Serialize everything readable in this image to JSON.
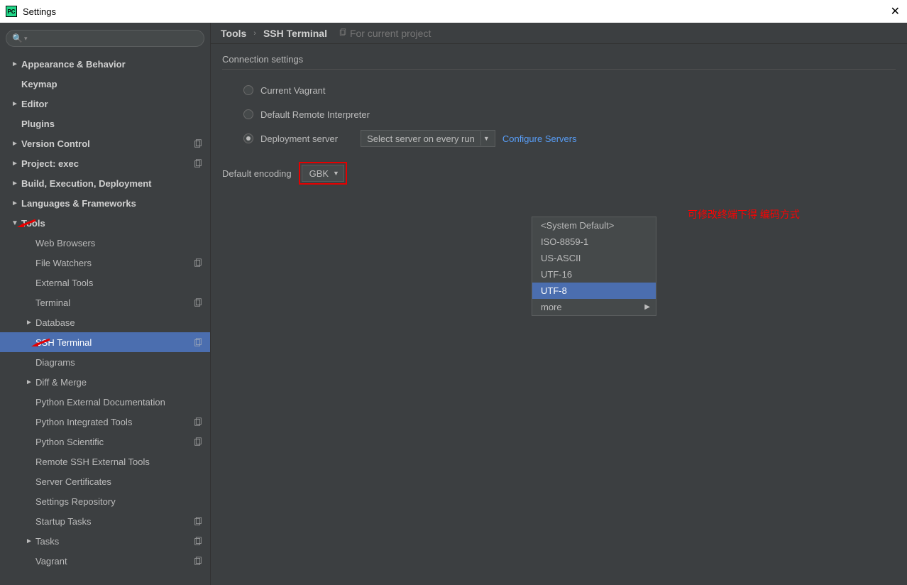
{
  "window": {
    "title": "Settings"
  },
  "breadcrumb": {
    "crumb1": "Tools",
    "crumb2": "SSH Terminal",
    "project_scope": "For current project"
  },
  "sidebar": {
    "items": [
      {
        "label": "Appearance & Behavior",
        "bold": true,
        "exp": "►",
        "copy": false,
        "lvl": 0
      },
      {
        "label": "Keymap",
        "bold": true,
        "exp": "",
        "copy": false,
        "lvl": 0
      },
      {
        "label": "Editor",
        "bold": true,
        "exp": "►",
        "copy": false,
        "lvl": 0
      },
      {
        "label": "Plugins",
        "bold": true,
        "exp": "",
        "copy": false,
        "lvl": 0
      },
      {
        "label": "Version Control",
        "bold": true,
        "exp": "►",
        "copy": true,
        "lvl": 0
      },
      {
        "label": "Project: exec",
        "bold": true,
        "exp": "►",
        "copy": true,
        "lvl": 0
      },
      {
        "label": "Build, Execution, Deployment",
        "bold": true,
        "exp": "►",
        "copy": false,
        "lvl": 0
      },
      {
        "label": "Languages & Frameworks",
        "bold": true,
        "exp": "►",
        "copy": false,
        "lvl": 0
      },
      {
        "label": "Tools",
        "bold": true,
        "exp": "▼",
        "copy": false,
        "lvl": 0,
        "arrow": true
      },
      {
        "label": "Web Browsers",
        "bold": false,
        "exp": "",
        "copy": false,
        "lvl": 1
      },
      {
        "label": "File Watchers",
        "bold": false,
        "exp": "",
        "copy": true,
        "lvl": 1
      },
      {
        "label": "External Tools",
        "bold": false,
        "exp": "",
        "copy": false,
        "lvl": 1
      },
      {
        "label": "Terminal",
        "bold": false,
        "exp": "",
        "copy": true,
        "lvl": 1
      },
      {
        "label": "Database",
        "bold": false,
        "exp": "►",
        "copy": false,
        "lvl": 1
      },
      {
        "label": "SSH Terminal",
        "bold": false,
        "exp": "",
        "copy": true,
        "lvl": 1,
        "selected": true,
        "arrow": true
      },
      {
        "label": "Diagrams",
        "bold": false,
        "exp": "",
        "copy": false,
        "lvl": 1
      },
      {
        "label": "Diff & Merge",
        "bold": false,
        "exp": "►",
        "copy": false,
        "lvl": 1
      },
      {
        "label": "Python External Documentation",
        "bold": false,
        "exp": "",
        "copy": false,
        "lvl": 1
      },
      {
        "label": "Python Integrated Tools",
        "bold": false,
        "exp": "",
        "copy": true,
        "lvl": 1
      },
      {
        "label": "Python Scientific",
        "bold": false,
        "exp": "",
        "copy": true,
        "lvl": 1
      },
      {
        "label": "Remote SSH External Tools",
        "bold": false,
        "exp": "",
        "copy": false,
        "lvl": 1
      },
      {
        "label": "Server Certificates",
        "bold": false,
        "exp": "",
        "copy": false,
        "lvl": 1
      },
      {
        "label": "Settings Repository",
        "bold": false,
        "exp": "",
        "copy": false,
        "lvl": 1
      },
      {
        "label": "Startup Tasks",
        "bold": false,
        "exp": "",
        "copy": true,
        "lvl": 1
      },
      {
        "label": "Tasks",
        "bold": false,
        "exp": "►",
        "copy": true,
        "lvl": 1
      },
      {
        "label": "Vagrant",
        "bold": false,
        "exp": "",
        "copy": true,
        "lvl": 1
      }
    ]
  },
  "content": {
    "section_title": "Connection settings",
    "radio1": "Current Vagrant",
    "radio2": "Default Remote Interpreter",
    "radio3": "Deployment server",
    "combo_server": "Select server on every run",
    "link_configure": "Configure Servers",
    "enc_label": "Default encoding",
    "enc_value": "GBK",
    "annotation": "可修改终端下得  编码方式",
    "dropdown": [
      "<System Default>",
      "ISO-8859-1",
      "US-ASCII",
      "UTF-16",
      "UTF-8",
      "more"
    ]
  }
}
